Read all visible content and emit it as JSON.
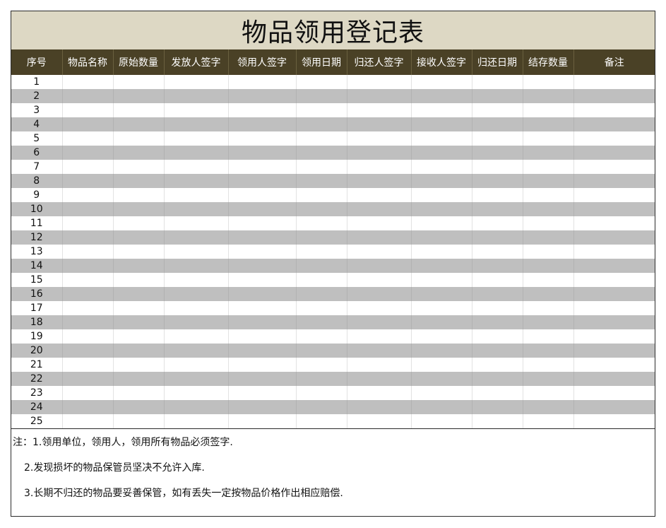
{
  "title": "物品领用登记表",
  "columns": [
    "序号",
    "物品名称",
    "原始数量",
    "发放人签字",
    "领用人签字",
    "领用日期",
    "归还人签字",
    "接收人签字",
    "归还日期",
    "结存数量",
    "备注"
  ],
  "rows": [
    "1",
    "2",
    "3",
    "4",
    "5",
    "6",
    "7",
    "8",
    "9",
    "10",
    "11",
    "12",
    "13",
    "14",
    "15",
    "16",
    "17",
    "18",
    "19",
    "20",
    "21",
    "22",
    "23",
    "24",
    "25"
  ],
  "notes": [
    "注：1.领用单位，领用人，领用所有物品必须签字.",
    "2.发现损坏的物品保管员坚决不允许入库.",
    "3.长期不归还的物品要妥善保管，如有丢失一定按物品价格作出相应赔偿."
  ],
  "colors": {
    "title_bg": "#ddd8c4",
    "header_bg": "#4a4126",
    "stripe": "#bfbfbf"
  }
}
